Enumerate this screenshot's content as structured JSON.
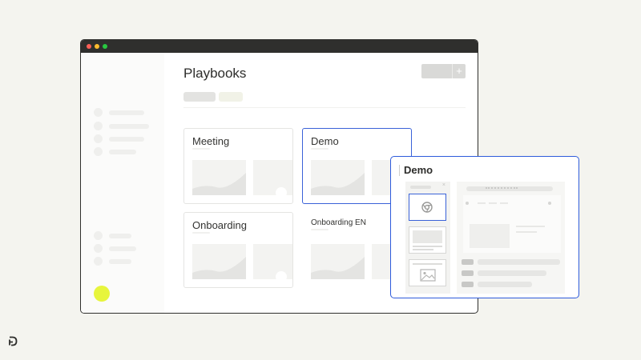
{
  "page": {
    "title": "Playbooks",
    "add_button_icon": "+",
    "filters": [
      "",
      ""
    ]
  },
  "cards": [
    {
      "title": "Meeting",
      "selected": false
    },
    {
      "title": "Demo",
      "selected": true
    },
    {
      "title": "Onboarding",
      "selected": false
    },
    {
      "title": "Onboarding EN",
      "selected": false
    }
  ],
  "popup": {
    "title": "Demo",
    "slides_close_icon": "×"
  },
  "colors": {
    "accent": "#2e5bdb",
    "avatar": "#e7f53c",
    "titlebar": "#2f2f2d",
    "background": "#f4f4ef"
  },
  "icons": [
    "chrome-icon",
    "image-icon",
    "plus-icon",
    "brand-logo-icon"
  ]
}
